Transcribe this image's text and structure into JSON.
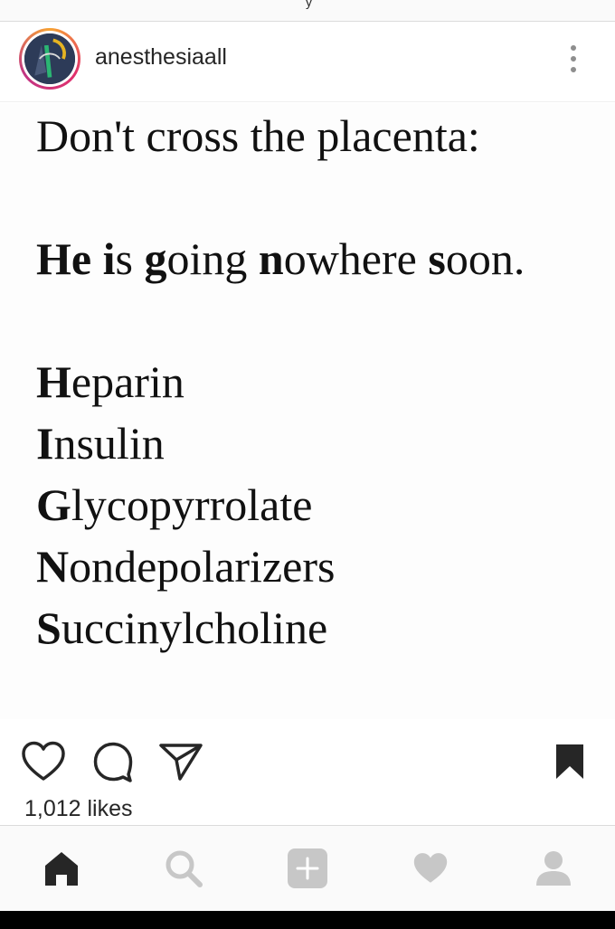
{
  "status_bar": {
    "partial_glyph": "y"
  },
  "post": {
    "username": "anesthesiaall",
    "avatar_icon": "profile-picture-icon",
    "more_icon": "more-vertical-icon",
    "image_text": {
      "title": "Don't cross the placenta:",
      "mnemonic": [
        {
          "bold": "He",
          "rest": " "
        },
        {
          "bold": "i",
          "rest": "s "
        },
        {
          "bold": "g",
          "rest": "oing "
        },
        {
          "bold": "n",
          "rest": "owhere "
        },
        {
          "bold": "s",
          "rest": "oon."
        }
      ],
      "drugs": [
        {
          "initial": "H",
          "rest": "eparin"
        },
        {
          "initial": "I",
          "rest": "nsulin"
        },
        {
          "initial": "G",
          "rest": "lycopyrrolate"
        },
        {
          "initial": "N",
          "rest": "ondepolarizers"
        },
        {
          "initial": "S",
          "rest": "uccinylcholine"
        }
      ]
    },
    "actions": [
      "like-icon",
      "comment-icon",
      "share-icon",
      "save-icon"
    ],
    "likes": "1,012 likes"
  },
  "bottom_nav": {
    "items": [
      "home-icon",
      "search-icon",
      "add-icon",
      "activity-heart-icon",
      "profile-icon"
    ],
    "active": "home-icon"
  },
  "colors": {
    "text": "#262626",
    "inactive_icon": "#c7c7c7",
    "ring_start": "#f7a334",
    "ring_end": "#c13584"
  }
}
